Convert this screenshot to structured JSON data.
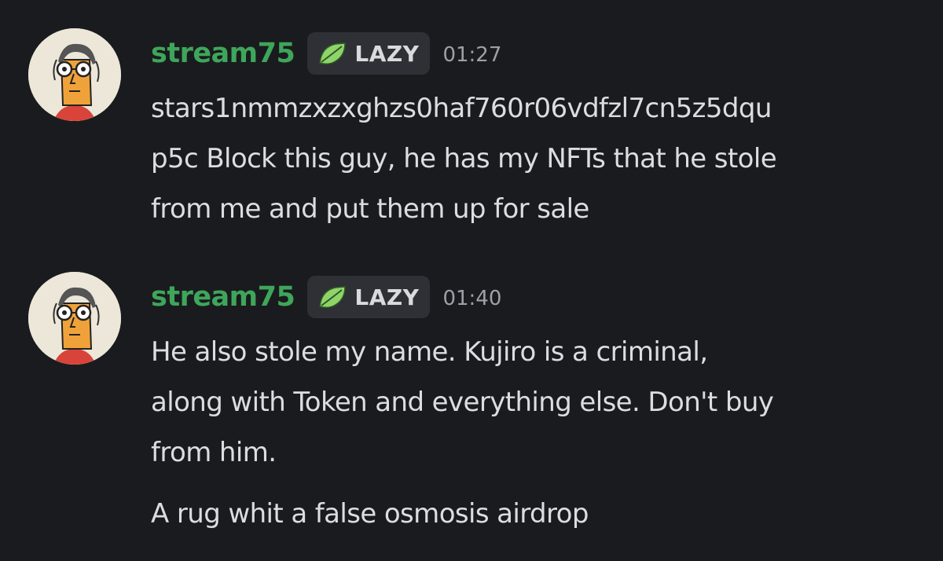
{
  "messages": [
    {
      "username": "stream75",
      "role_tag": "LAZY",
      "role_icon": "leaf-icon",
      "timestamp": "01:27",
      "lines": [
        "stars1nmmzxzxghzs0haf760r06vdfzl7cn5z5dqu",
        "p5c Block this guy, he has my NFTs that he stole",
        "from me and put them up for sale"
      ]
    },
    {
      "username": "stream75",
      "role_tag": "LAZY",
      "role_icon": "leaf-icon",
      "timestamp": "01:40",
      "lines": [
        "He also stole my name. Kujiro is a criminal,",
        "along with Token and everything else. Don't buy",
        "from him."
      ],
      "followup": "A rug whit a false osmosis airdrop"
    }
  ],
  "colors": {
    "background": "#1a1b1f",
    "username": "#3ea65a",
    "tag_background": "#2e3036",
    "text": "#dcdde0",
    "timestamp": "#9da0a7"
  }
}
